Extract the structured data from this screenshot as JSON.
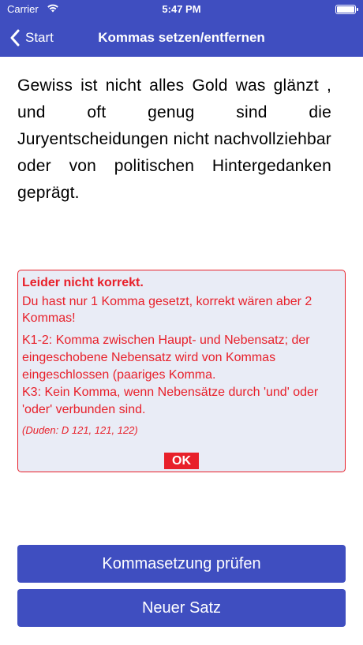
{
  "status_bar": {
    "carrier": "Carrier",
    "time": "5:47 PM",
    "wifi_icon": "wifi-icon",
    "battery_icon": "battery-icon"
  },
  "nav": {
    "back_label": "Start",
    "back_icon": "chevron-left-icon",
    "title": "Kommas setzen/entfernen"
  },
  "sentence": "Gewiss ist nicht alles Gold was glänzt , und oft genug sind die Juryentscheidungen nicht nachvollziehbar oder von politischen Hintergedanken geprägt.",
  "feedback": {
    "heading": "Leider nicht korrekt.",
    "message": "Du hast nur 1 Komma gesetzt, korrekt wären aber 2 Kommas!",
    "rules": "K1-2: Komma zwischen Haupt- und Nebensatz; der eingeschobene Nebensatz wird von Kommas eingeschlossen (paariges Komma.\nK3: Kein Komma, wenn Nebensätze durch 'und' oder 'oder' verbunden sind.",
    "source": "(Duden: D 121, 121, 122)",
    "ok_label": "OK"
  },
  "buttons": {
    "check_label": "Kommasetzung prüfen",
    "new_sentence_label": "Neuer Satz"
  },
  "colors": {
    "primary": "#3f4ec0",
    "error": "#e8202a",
    "feedback_bg": "#e9ecf6"
  }
}
